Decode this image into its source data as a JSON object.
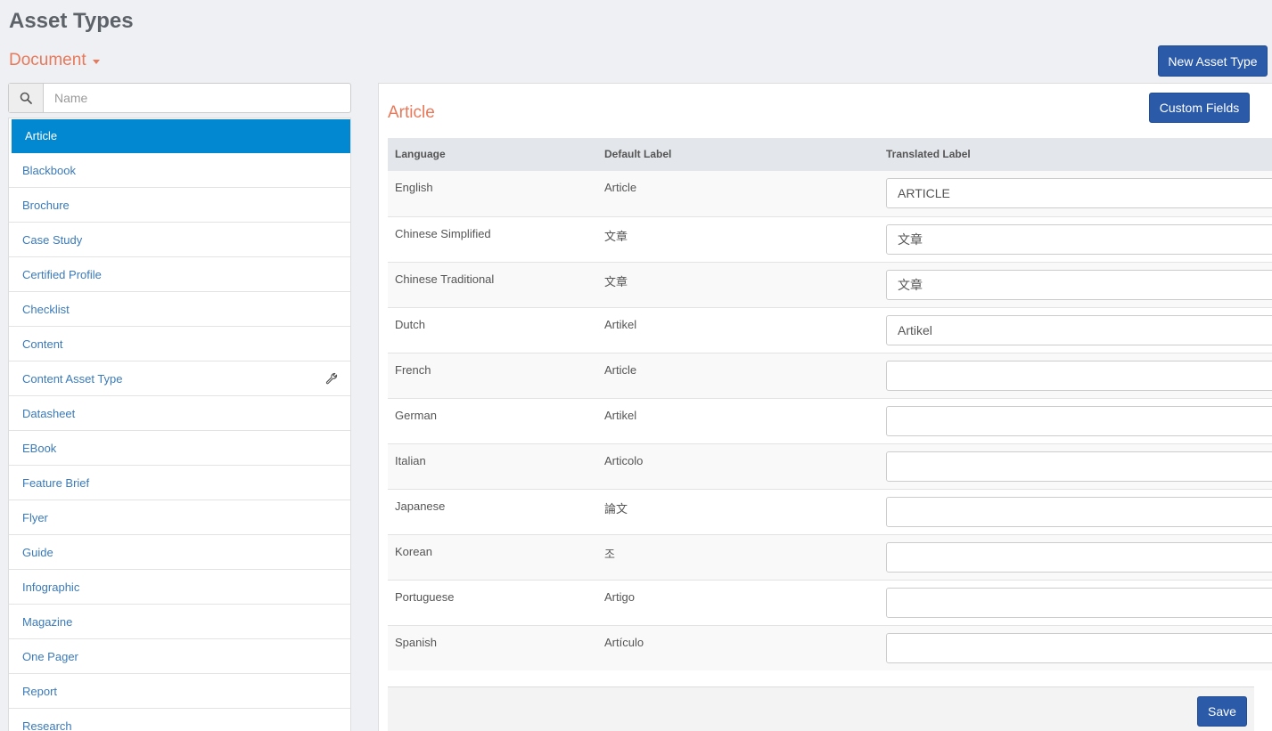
{
  "header": {
    "title": "Asset Types",
    "category": "Document",
    "new_button": "New Asset Type"
  },
  "search": {
    "placeholder": "Name"
  },
  "asset_types": [
    {
      "label": "Article",
      "active": true
    },
    {
      "label": "Blackbook"
    },
    {
      "label": "Brochure"
    },
    {
      "label": "Case Study"
    },
    {
      "label": "Certified Profile"
    },
    {
      "label": "Checklist"
    },
    {
      "label": "Content"
    },
    {
      "label": "Content Asset Type",
      "icon": "wrench-icon"
    },
    {
      "label": "Datasheet"
    },
    {
      "label": "EBook"
    },
    {
      "label": "Feature Brief"
    },
    {
      "label": "Flyer"
    },
    {
      "label": "Guide"
    },
    {
      "label": "Infographic"
    },
    {
      "label": "Magazine"
    },
    {
      "label": "One Pager"
    },
    {
      "label": "Report"
    },
    {
      "label": "Research"
    }
  ],
  "panel": {
    "title": "Article",
    "custom_fields_button": "Custom Fields",
    "columns": {
      "language": "Language",
      "default_label": "Default Label",
      "translated_label": "Translated Label"
    },
    "rows": [
      {
        "language": "English",
        "default": "Article",
        "translated": "ARTICLE"
      },
      {
        "language": "Chinese Simplified",
        "default": "文章",
        "translated": "文章"
      },
      {
        "language": "Chinese Traditional",
        "default": "文章",
        "translated": "文章"
      },
      {
        "language": "Dutch",
        "default": "Artikel",
        "translated": "Artikel"
      },
      {
        "language": "French",
        "default": "Article",
        "translated": ""
      },
      {
        "language": "German",
        "default": "Artikel",
        "translated": ""
      },
      {
        "language": "Italian",
        "default": "Articolo",
        "translated": ""
      },
      {
        "language": "Japanese",
        "default": "論文",
        "translated": ""
      },
      {
        "language": "Korean",
        "default": "조",
        "translated": ""
      },
      {
        "language": "Portuguese",
        "default": "Artigo",
        "translated": ""
      },
      {
        "language": "Spanish",
        "default": "Artículo",
        "translated": ""
      }
    ],
    "save_button": "Save"
  },
  "colors": {
    "accent": "#e8795a",
    "primary_button": "#2a5aa8",
    "active_item": "#0288d1",
    "link": "#3a7ab8"
  }
}
